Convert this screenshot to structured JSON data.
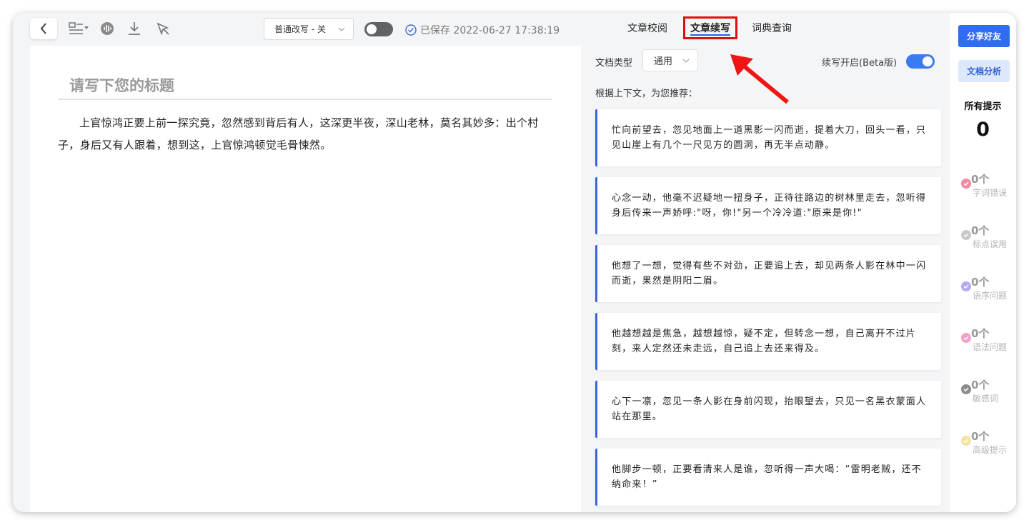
{
  "toolbar": {
    "mode_select": "普通改写 - 关",
    "saved_text": "已保存 2022-06-27 17:38:19",
    "icons": [
      "back-icon",
      "layout-icon",
      "voice-icon",
      "download-icon",
      "magic-pen-icon",
      "chevron-down-icon",
      "check-circle-icon"
    ]
  },
  "editor": {
    "title_placeholder": "请写下您的标题",
    "body": "上官惊鸿正要上前一探究竟，忽然感到背后有人，这深更半夜，深山老林，莫名其妙多：出个村子，身后又有人跟着，想到这，上官惊鸿顿觉毛骨悚然。"
  },
  "panel": {
    "tabs": [
      {
        "label": "文章校阅",
        "active": false
      },
      {
        "label": "文章续写",
        "active": true
      },
      {
        "label": "词典查询",
        "active": false
      }
    ],
    "doc_type_label": "文档类型",
    "doc_type_value": "通用",
    "continue_label": "续写开启(Beta版)",
    "continue_enabled": true,
    "recommend_label": "根据上下文，为您推荐：",
    "suggestions": [
      "忙向前望去，忽见地面上一道黑影一闪而逝，提着大刀，回头一看，只见山崖上有几个一尺见方的圆洞，再无半点动静。",
      "心念一动，他毫不迟疑地一扭身子，正待往路边的树林里走去，忽听得身后传来一声娇呼:\"呀，你!\"另一个冷冷道:\"原来是你!\"",
      "他想了一想，觉得有些不对劲，正要追上去，却见两条人影在林中一闪而逝，果然是阴阳二眉。",
      "他越想越是焦急，越想越惊，疑不定，但转念一想，自己离开不过片刻，来人定然还未走远，自己追上去还来得及。",
      "心下一凛，忽见一条人影在身前闪现，抬眼望去，只见一名黑衣蒙面人站在那里。",
      "他脚步一顿，正要看清来人是谁，忽听得一声大喝：“雷明老贼，还不纳命来！”"
    ]
  },
  "sidebar": {
    "share_label": "分享好友",
    "analysis_label": "文档分析",
    "all_hints_label": "所有提示",
    "all_hints_count": "0",
    "hints": [
      {
        "count": "0个",
        "name": "字词错误",
        "color": "#f08aa0"
      },
      {
        "count": "0个",
        "name": "标点误用",
        "color": "#c9c9c9"
      },
      {
        "count": "0个",
        "name": "语序问题",
        "color": "#b9a8f0"
      },
      {
        "count": "0个",
        "name": "语法问题",
        "color": "#f5a0c8"
      },
      {
        "count": "0个",
        "name": "敏感词",
        "color": "#8c8c8c"
      },
      {
        "count": "0个",
        "name": "高级提示",
        "color": "#f5e3a0"
      }
    ]
  },
  "colors": {
    "accent": "#2f6cf0",
    "highlight_box": "#e01010",
    "card_border": "#3f63d6"
  }
}
